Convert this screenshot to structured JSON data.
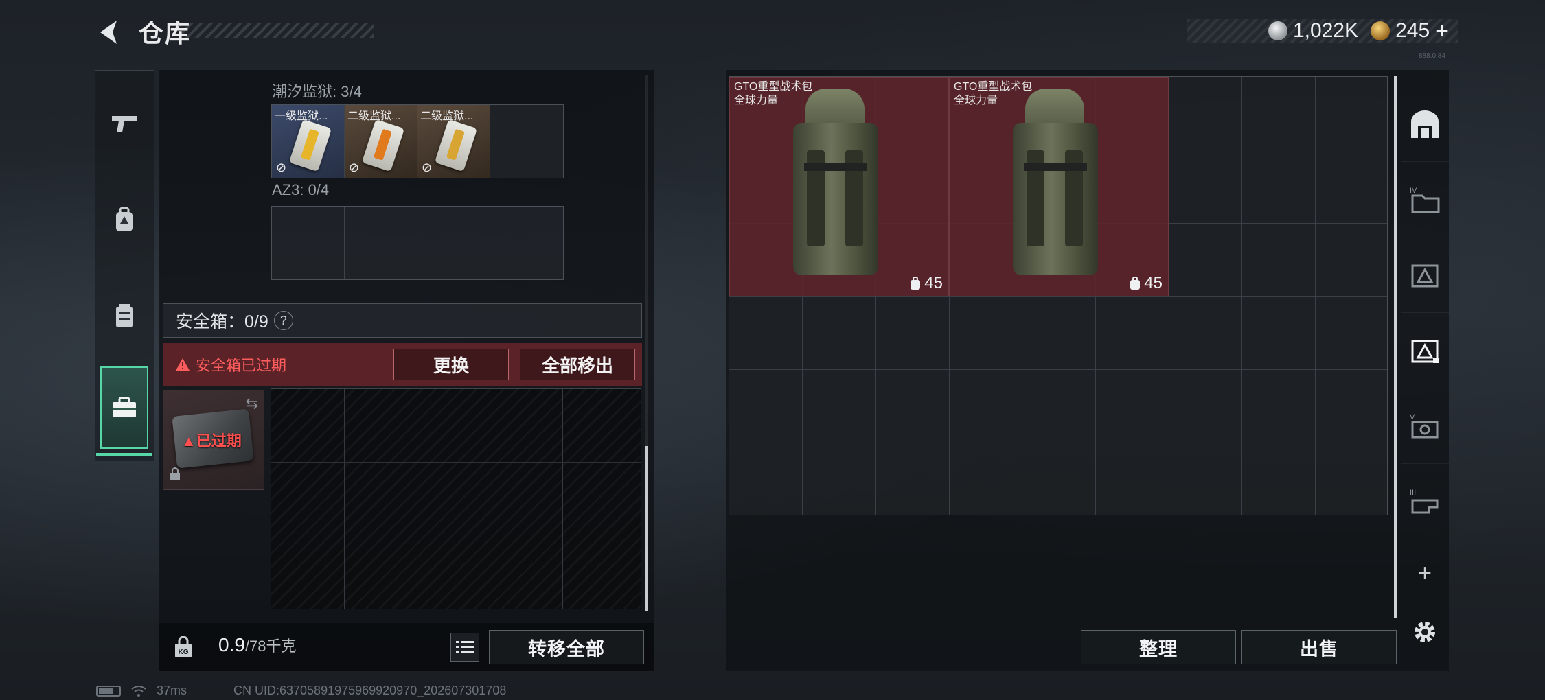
{
  "header": {
    "title": "仓库",
    "currency_silver": "1,022K",
    "currency_gold": "245",
    "currency_plus": "+",
    "version": "888.0.84"
  },
  "left": {
    "section1": {
      "label": "潮汐监狱: 3/4",
      "items": [
        "一级监狱...",
        "二级监狱...",
        "二级监狱..."
      ]
    },
    "section2": {
      "label": "AZ3: 0/4"
    },
    "safe": {
      "title": "安全箱：0/9",
      "help": "?",
      "expired_notice": "安全箱已过期",
      "replace_button": "更换",
      "move_all_button": "全部移出",
      "expired_tag": "已过期"
    },
    "weight_value": "0.9",
    "weight_unit": "/78千克",
    "transfer_all_button": "转移全部"
  },
  "right": {
    "items": [
      {
        "name": "GTO重型战术包",
        "subtitle": "全球力量",
        "count": "45"
      },
      {
        "name": "GTO重型战术包",
        "subtitle": "全球力量",
        "count": "45"
      }
    ],
    "organize_button": "整理",
    "sell_button": "出售",
    "add_tab": "+"
  },
  "status": {
    "ping": "37ms",
    "uid": "CN UID:63705891975969920970_202607301708"
  },
  "colors": {
    "accent_green": "#57d6a8",
    "expired_red": "#ff5d5d",
    "item_red_bg": "#5f242a"
  }
}
